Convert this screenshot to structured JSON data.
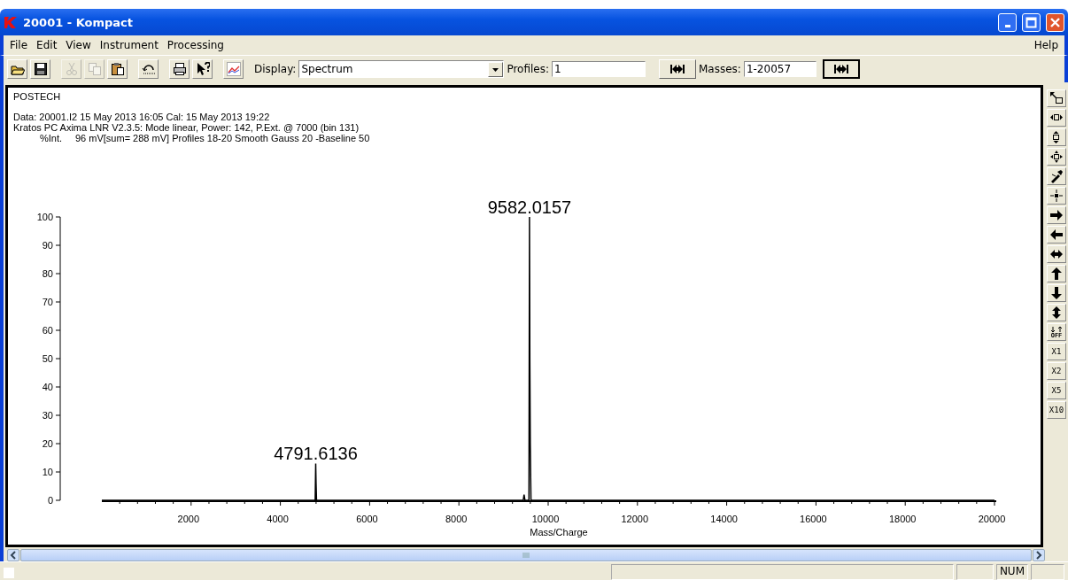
{
  "window": {
    "title": "20001 - Kompact"
  },
  "menu": [
    {
      "label": "File"
    },
    {
      "label": "Edit"
    },
    {
      "label": "View"
    },
    {
      "label": "Instrument"
    },
    {
      "label": "Processing"
    }
  ],
  "help_menu": {
    "label": "Help"
  },
  "toolbar": [
    {
      "kind": "open",
      "disabled": false
    },
    {
      "kind": "save",
      "disabled": false
    },
    {
      "kind": "cut",
      "disabled": true
    },
    {
      "kind": "copy",
      "disabled": true
    },
    {
      "kind": "paste",
      "disabled": false
    },
    {
      "kind": "undo",
      "disabled": false
    },
    {
      "kind": "print",
      "disabled": false
    },
    {
      "kind": "help",
      "disabled": false
    },
    {
      "kind": "chart",
      "disabled": false
    }
  ],
  "display": {
    "label": "Display:",
    "value": "Spectrum"
  },
  "profiles": {
    "label": "Profiles:",
    "value": "1"
  },
  "masses": {
    "label": "Masses:",
    "value": "1-20057"
  },
  "spectrum": {
    "header": "POSTECH",
    "info": [
      "Data: 20001.I2 15 May 2013 16:05 Cal: 15 May 2013 19:22",
      "Kratos PC Axima LNR V2.3.5: Mode linear, Power: 142, P.Ext. @ 7000 (bin 131)"
    ],
    "ylabel": "%Int.",
    "summary": "96 mV[sum= 288 mV]  Profiles 18-20 Smooth Gauss 20 -Baseline 50",
    "chart_data": {
      "type": "line",
      "xlabel": "Mass/Charge",
      "xlim": [
        0,
        20000
      ],
      "ylim": [
        0,
        100
      ],
      "xticks": [
        2000,
        4000,
        6000,
        8000,
        10000,
        12000,
        14000,
        16000,
        18000,
        20000
      ],
      "yticks": [
        0,
        10,
        20,
        30,
        40,
        50,
        60,
        70,
        80,
        90,
        100
      ],
      "x": [
        0,
        4780,
        4792,
        4800,
        4810,
        9440,
        9460,
        9480,
        9570,
        9582,
        9590,
        9600,
        9615,
        20000
      ],
      "series": [
        {
          "color": "#000000",
          "values": [
            0,
            0,
            13,
            6,
            0,
            0,
            2,
            0,
            0,
            100,
            50,
            20,
            0,
            0
          ]
        }
      ],
      "annotations": [
        {
          "x": 4791.6136,
          "y": 13,
          "text": "4791.6136"
        },
        {
          "x": 9582.0157,
          "y": 100,
          "text": "9582.0157"
        }
      ]
    }
  },
  "side_tools": [
    {
      "kind": "fit"
    },
    {
      "kind": "hzoom"
    },
    {
      "kind": "vzoom"
    },
    {
      "kind": "zoom"
    },
    {
      "kind": "tool"
    },
    {
      "kind": "shrink"
    },
    {
      "kind": "right"
    },
    {
      "kind": "left"
    },
    {
      "kind": "leftright"
    },
    {
      "kind": "up"
    },
    {
      "kind": "down"
    },
    {
      "kind": "updown"
    },
    {
      "kind": "offset",
      "label": "OFF"
    },
    {
      "kind": "scale",
      "label": "X1"
    },
    {
      "kind": "scale",
      "label": "X2"
    },
    {
      "kind": "scale",
      "label": "X5"
    },
    {
      "kind": "scale",
      "label": "X10"
    }
  ],
  "status_bar": {
    "indicator": "NUM"
  }
}
